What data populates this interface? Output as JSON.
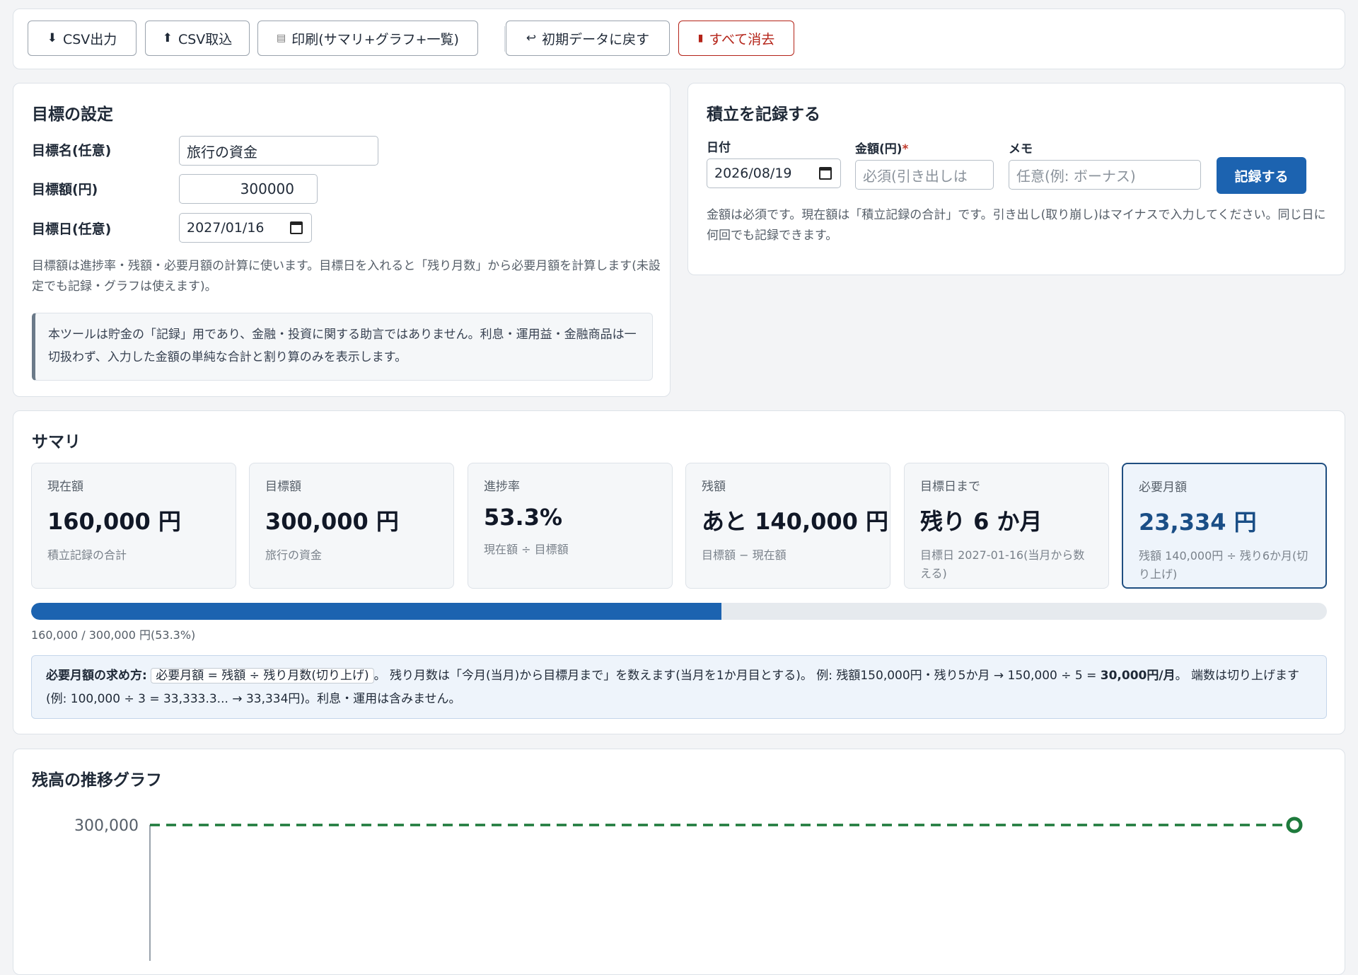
{
  "toolbar": {
    "csv_export": "CSV出力",
    "csv_import": "CSV取込",
    "print": "印刷(サマリ+グラフ+一覧)",
    "reset": "初期データに戻す",
    "clear_all": "すべて消去"
  },
  "goal": {
    "title": "目標の設定",
    "name_label": "目標名(任意)",
    "name_value": "旅行の資金",
    "amount_label": "目標額(円)",
    "amount_value": "300000",
    "date_label": "目標日(任意)",
    "date_value": "2027/01/16",
    "help": "目標額は進捗率・残額・必要月額の計算に使います。目標日を入れると「残り月数」から必要月額を計算します(未設定でも記録・グラフは使えます)。",
    "disclaimer": "本ツールは貯金の「記録」用であり、金融・投資に関する助言ではありません。利息・運用益・金融商品は一切扱わず、入力した金額の単純な合計と割り算のみを表示します。"
  },
  "record": {
    "title": "積立を記録する",
    "date_label": "日付",
    "date_value": "2026/08/19",
    "amount_label": "金額(円)",
    "required_mark": "*",
    "amount_placeholder": "必須(引き出しは",
    "memo_label": "メモ",
    "memo_placeholder": "任意(例: ボーナス)",
    "submit": "記録する",
    "help": "金額は必須です。現在額は「積立記録の合計」です。引き出し(取り崩し)はマイナスで入力してください。同じ日に何回でも記録できます。"
  },
  "summary": {
    "title": "サマリ",
    "cards": [
      {
        "title": "現在額",
        "value": "160,000 円",
        "sub": "積立記録の合計"
      },
      {
        "title": "目標額",
        "value": "300,000 円",
        "sub": "旅行の資金"
      },
      {
        "title": "進捗率",
        "value": "53.3%",
        "sub": "現在額 ÷ 目標額"
      },
      {
        "title": "残額",
        "value": "あと 140,000 円",
        "sub": "目標額 − 現在額"
      },
      {
        "title": "目標日まで",
        "value": "残り 6 か月",
        "sub": "目標日 2027-01-16(当月から数える)"
      },
      {
        "title": "必要月額",
        "value": "23,334 円",
        "sub": "残額 140,000円 ÷ 残り6か月(切り上げ)"
      }
    ],
    "progress": 0.533,
    "progress_label": "160,000 / 300,000 円(53.3%)",
    "formula": {
      "lead": "必要月額の求め方:",
      "code": "必要月額 = 残額 ÷ 残り月数(切り上げ)",
      "text1": "。 残り月数は「今月(当月)から目標月まで」を数えます(当月を1か月目とする)。 例: 残額150,000円・残り5か月 → 150,000 ÷ 5 = ",
      "bold": "30,000円/月",
      "text2": "。 端数は切り上げます(例: 100,000 ÷ 3 = 33,333.3... → 33,334円)。利息・運用は含みません。"
    }
  },
  "chart": {
    "title": "残高の推移グラフ",
    "colors": {
      "goal_line": "#1e7a3c",
      "axis": "#9aa3ad"
    }
  },
  "chart_data": {
    "type": "line",
    "title": "残高の推移グラフ",
    "y_ticks": [
      "300,000"
    ],
    "goal": 300000,
    "y_top_tick": 300000,
    "series": []
  }
}
